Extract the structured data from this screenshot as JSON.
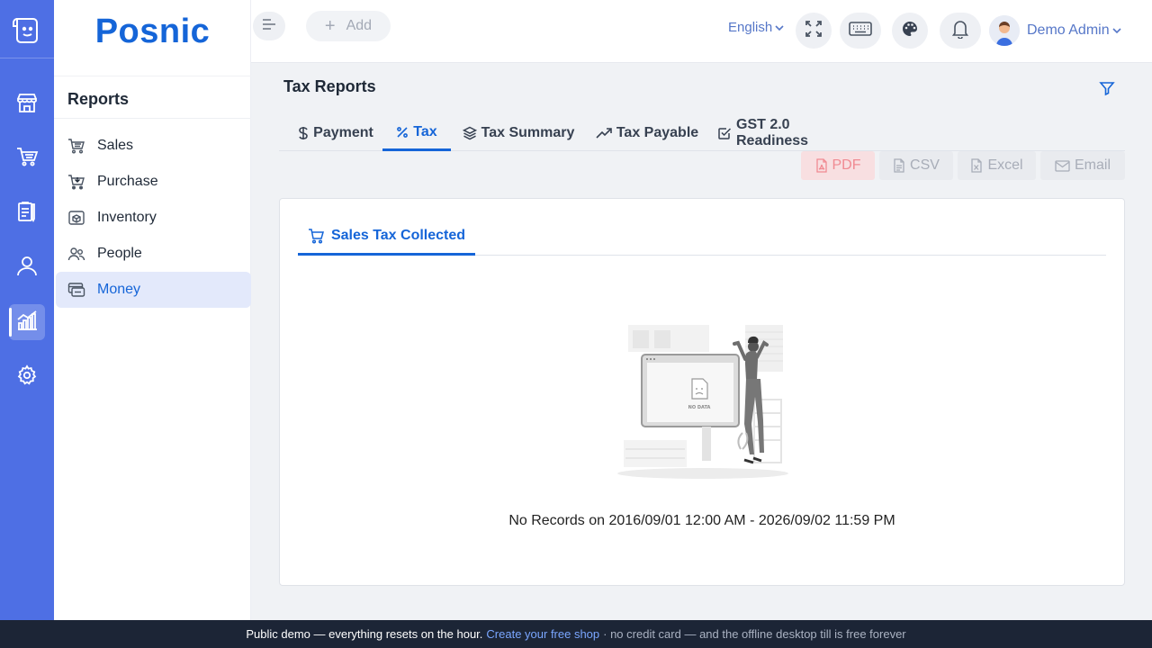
{
  "brand": {
    "name": "Posnic"
  },
  "rail": {
    "items": [
      {
        "icon": "store-icon"
      },
      {
        "icon": "cart-icon"
      },
      {
        "icon": "clipboard-icon"
      },
      {
        "icon": "user-icon"
      },
      {
        "icon": "bar-chart-icon",
        "active": true
      },
      {
        "icon": "gear-icon"
      }
    ]
  },
  "sidebar": {
    "title": "Reports",
    "items": [
      {
        "label": "Sales",
        "icon": "basket-icon"
      },
      {
        "label": "Purchase",
        "icon": "purchase-cart-icon"
      },
      {
        "label": "Inventory",
        "icon": "box-icon"
      },
      {
        "label": "People",
        "icon": "people-icon"
      },
      {
        "label": "Money",
        "icon": "money-icon",
        "active": true
      }
    ]
  },
  "header": {
    "add_label": "Add",
    "language": "English",
    "user_name": "Demo Admin"
  },
  "main": {
    "title": "Tax Reports",
    "tabs": [
      {
        "label": "Payment",
        "icon": "dollar-icon"
      },
      {
        "label": "Tax",
        "icon": "percent-icon",
        "active": true
      },
      {
        "label": "Tax Summary",
        "icon": "layers-icon"
      },
      {
        "label": "Tax Payable",
        "icon": "trend-up-icon"
      },
      {
        "label": "GST 2.0 Readiness",
        "icon": "check-square-icon"
      }
    ],
    "exports": [
      {
        "label": "PDF",
        "icon": "pdf-icon"
      },
      {
        "label": "CSV",
        "icon": "csv-icon"
      },
      {
        "label": "Excel",
        "icon": "excel-icon"
      },
      {
        "label": "Email",
        "icon": "email-icon"
      }
    ],
    "subtab": "Sales Tax Collected",
    "illustration_text": "NO DATA",
    "empty_message": "No Records on 2016/09/01 12:00 AM - 2026/09/02 11:59 PM"
  },
  "banner": {
    "text": "Public demo — everything resets on the hour.",
    "link": "Create your free shop",
    "suffix": "· no credit card — and the offline desktop till is free forever"
  },
  "colors": {
    "rail": "#4e6fe4",
    "accent": "#1565d8",
    "active_bg": "#e3e9fb",
    "pdf_bg": "#f8dfe1",
    "banner": "#1c2536"
  }
}
